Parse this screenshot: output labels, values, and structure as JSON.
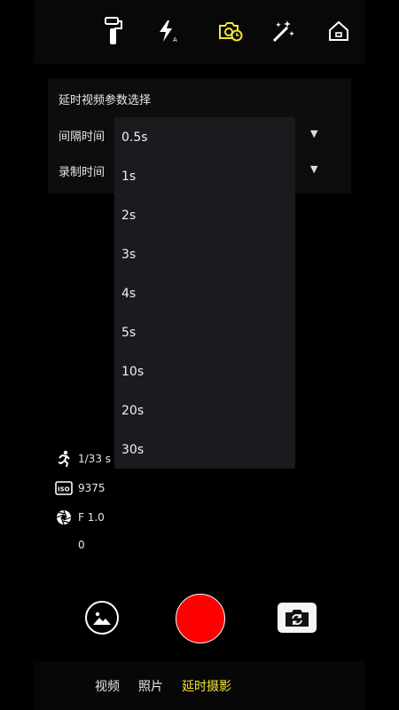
{
  "top_toolbar": {
    "icons": [
      "gimbal-icon",
      "flash-auto-icon",
      "timelapse-camera-icon",
      "magic-wand-icon",
      "home-icon"
    ],
    "accent_color": "#f3e534"
  },
  "settings_panel": {
    "title": "延时视频参数选择",
    "interval_label": "间隔时间",
    "record_label": "录制时间"
  },
  "interval_dropdown": {
    "options": [
      "0.5s",
      "1s",
      "2s",
      "3s",
      "4s",
      "5s",
      "10s",
      "20s",
      "30s"
    ]
  },
  "camera_params": {
    "shutter_speed": "1/33 s",
    "iso": "9375",
    "aperture": "F 1.0",
    "exposure_value": "0"
  },
  "controls": {
    "record_color": "#ff0000"
  },
  "mode_tabs": {
    "video": "视频",
    "photo": "照片",
    "timelapse": "延时摄影",
    "active": "延时摄影"
  }
}
